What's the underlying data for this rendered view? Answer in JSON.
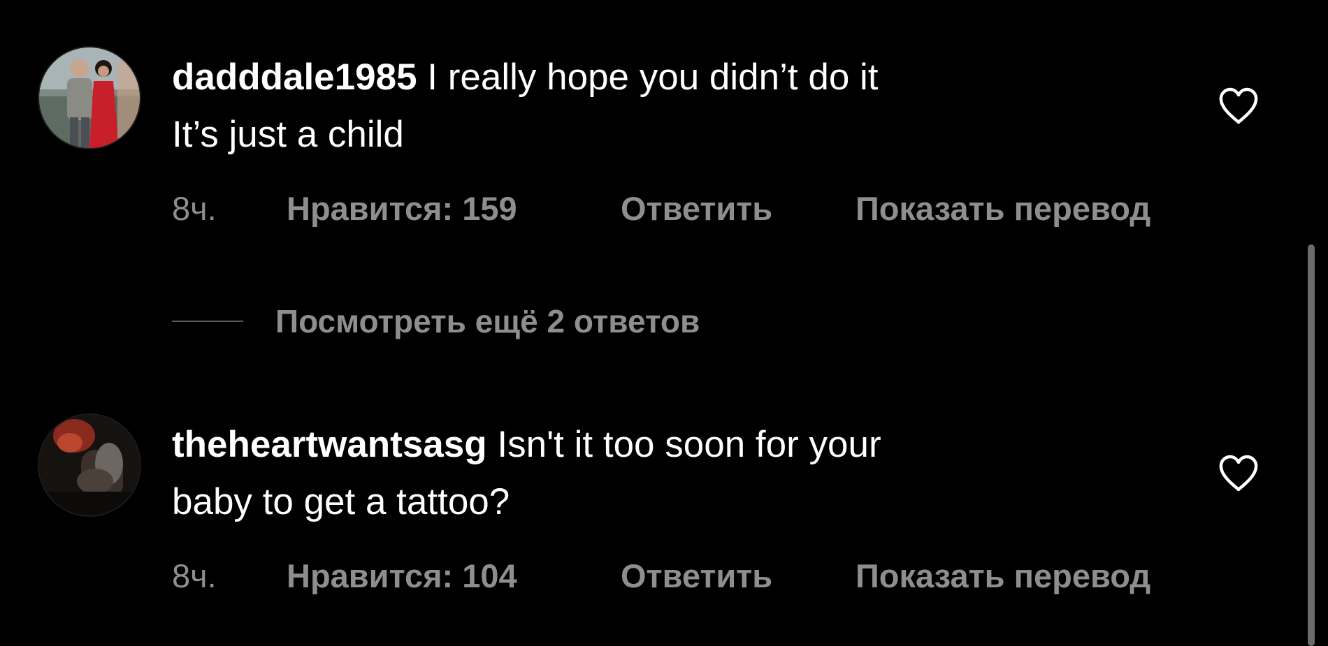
{
  "comments": [
    {
      "username": "dadddale1985",
      "text_line1": " I really hope you didn’t do it",
      "text_line2": "It’s just a child",
      "time": "8ч.",
      "likes": "Нравится: 159",
      "reply_label": "Ответить",
      "translate_label": "Показать перевод",
      "avatar_icon": "profile-photo-couple"
    },
    {
      "username": "theheartwantsasg",
      "text_line1": " Isn't it too soon for your",
      "text_line2": "baby to get a tattoo?",
      "time": "8ч.",
      "likes": "Нравится: 104",
      "reply_label": "Ответить",
      "translate_label": "Показать перевод",
      "avatar_icon": "profile-photo-dark"
    }
  ],
  "view_replies_label": "Посмотреть ещё 2 ответов",
  "icons": {
    "like": "heart-outline-icon"
  },
  "colors": {
    "background": "#000000",
    "text": "#ffffff",
    "secondary_text": "#8e8e8e"
  }
}
